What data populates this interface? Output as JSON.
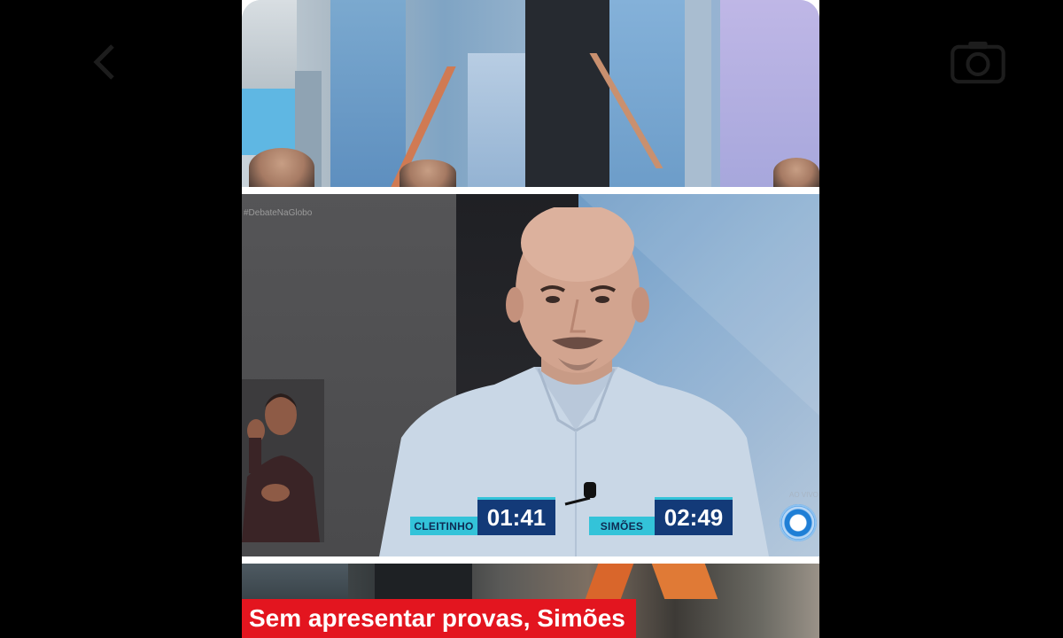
{
  "viewer": {
    "back_icon": "chevron-left-icon",
    "camera_icon": "camera-icon"
  },
  "broadcast": {
    "watermark": "#DebateNaGlobo",
    "live_label": "AO VIVO",
    "brand_color": "#e3151f"
  },
  "timers": [
    {
      "name": "CLEITINHO",
      "time": "01:41"
    },
    {
      "name": "SIMÕES",
      "time": "02:49"
    }
  ],
  "headline": {
    "text": "Sem apresentar provas, Simões"
  },
  "colors": {
    "timer_label_bg": "#33c3d9",
    "timer_value_bg": "#133a78",
    "headline_bg": "#e3151f"
  }
}
